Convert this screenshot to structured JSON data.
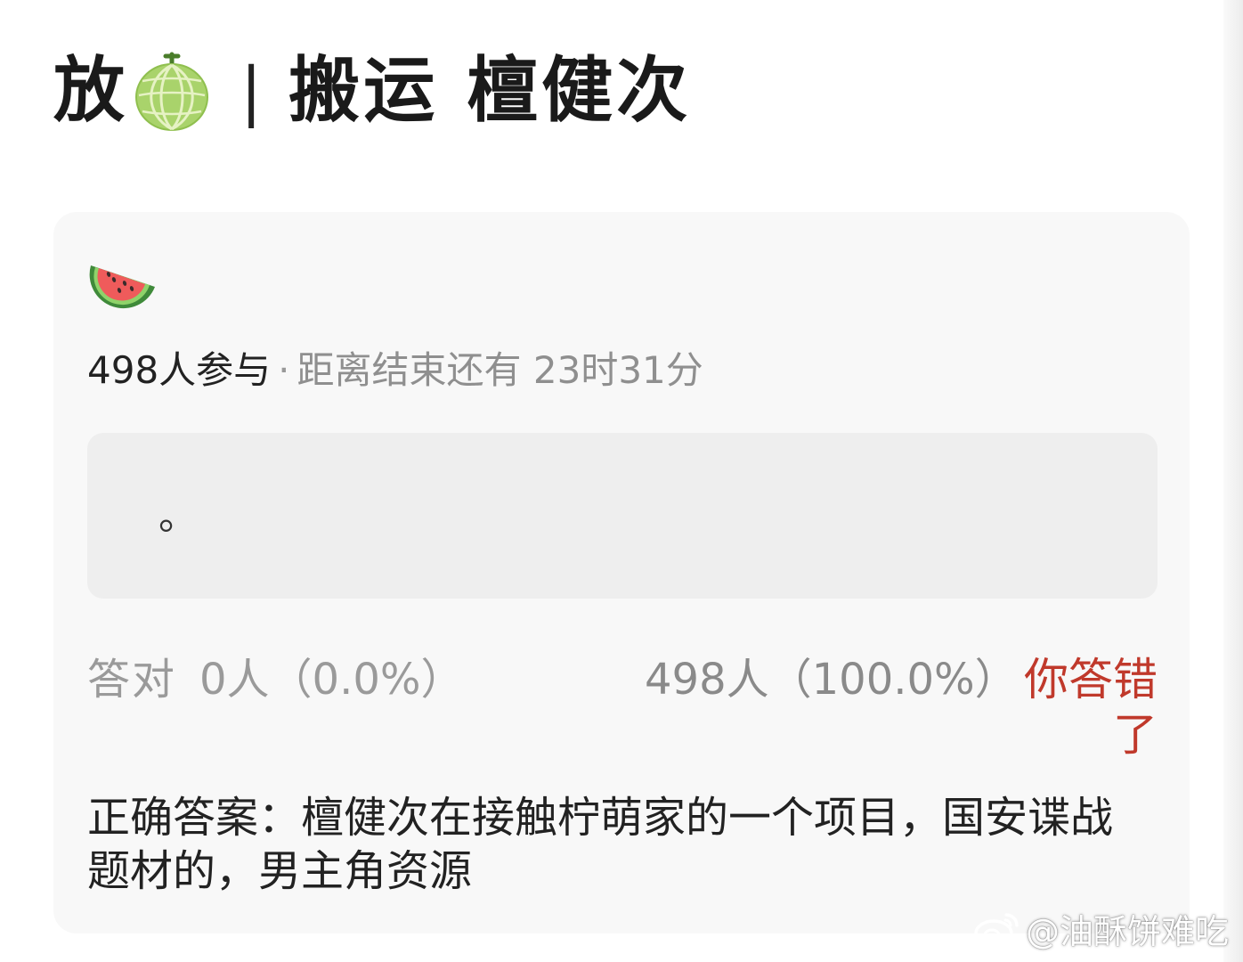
{
  "header": {
    "title_char": "放",
    "melon_icon": "melon-icon",
    "separator": "|",
    "subtitle": "搬运 檀健次"
  },
  "quiz": {
    "icon": "watermelon-icon",
    "participants": "498人参与",
    "dot": "·",
    "remaining": "距离结束还有 23时31分",
    "option_text": "。",
    "correct_label": "答对",
    "correct_value": "0人（0.0%）",
    "wrong_value": "498人（100.0%）",
    "wrong_badge": "你答错了",
    "answer": "正确答案：檀健次在接触柠萌家的一个项目，国安谍战题材的，男主角资源"
  },
  "watermark": {
    "logo_icon": "weibo-logo-icon",
    "text": "@油酥饼难吃"
  },
  "colors": {
    "card_bg": "#f8f8f8",
    "option_bg": "#eeeeee",
    "wrong_red": "#c0392b",
    "muted_gray": "#9a9a9a"
  }
}
